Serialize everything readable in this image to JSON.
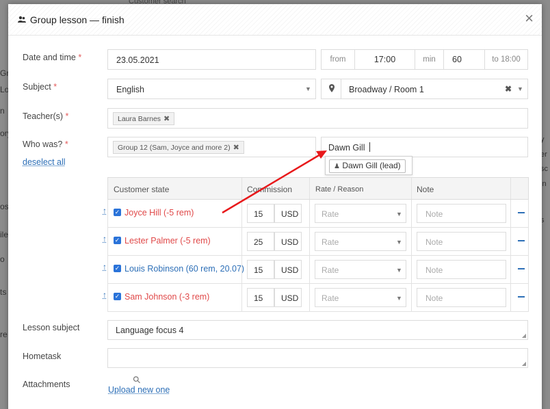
{
  "background": {
    "top_text": "Customer search",
    "left_fragments": [
      "Gr",
      "Lo",
      "n",
      "ory",
      "oss",
      "ile",
      "o",
      "ts",
      "re"
    ],
    "right_fragments": [
      "y",
      "er",
      "sc",
      "in",
      "s"
    ]
  },
  "modal": {
    "title": "Group lesson — finish",
    "title_icon": "users-icon",
    "close_label": "×"
  },
  "form": {
    "date_label": "Date and time",
    "required_mark": "*",
    "date_value": "23.05.2021",
    "from_label": "from",
    "time_value": "17:00",
    "min_label": "min",
    "duration_value": "60",
    "to_label": "to 18:00",
    "subject_label": "Subject",
    "subject_value": "English",
    "room_value": "Broadway / Room 1",
    "teacher_label": "Teacher(s)",
    "teacher_tag": "Laura Barnes",
    "who_label": "Who was?",
    "deselect_label": "deselect all",
    "group_tag": "Group 12 (Sam, Joyce and more 2)",
    "search_value": "Dawn Gill",
    "suggestion": "Dawn Gill (lead)",
    "lesson_subject_label": "Lesson subject",
    "lesson_subject_value": "Language focus 4",
    "hometask_label": "Hometask",
    "hometask_value": "",
    "attachments_label": "Attachments",
    "upload_label": "Upload new one"
  },
  "table": {
    "headers": {
      "state": "Customer state",
      "commission": "Commission",
      "rate": "Rate / Reason",
      "note": "Note"
    },
    "rows": [
      {
        "name": "Joyce Hill (-5 rem)",
        "amount": "15",
        "currency": "USD",
        "rate": "Rate",
        "note": "Note",
        "color": "#e04848"
      },
      {
        "name": "Lester Palmer (-5 rem)",
        "amount": "25",
        "currency": "USD",
        "rate": "Rate",
        "note": "Note",
        "color": "#e04848"
      },
      {
        "name": "Louis Robinson (60 rem, 20.07)",
        "amount": "15",
        "currency": "USD",
        "rate": "Rate",
        "note": "Note",
        "color": "#2d6fb7"
      },
      {
        "name": "Sam Johnson (-3 rem)",
        "amount": "15",
        "currency": "USD",
        "rate": "Rate",
        "note": "Note",
        "color": "#e04848"
      }
    ]
  },
  "colors": {
    "annotation_arrow": "#e8191b",
    "link": "#2d6fb7",
    "required": "#e35b5b"
  }
}
